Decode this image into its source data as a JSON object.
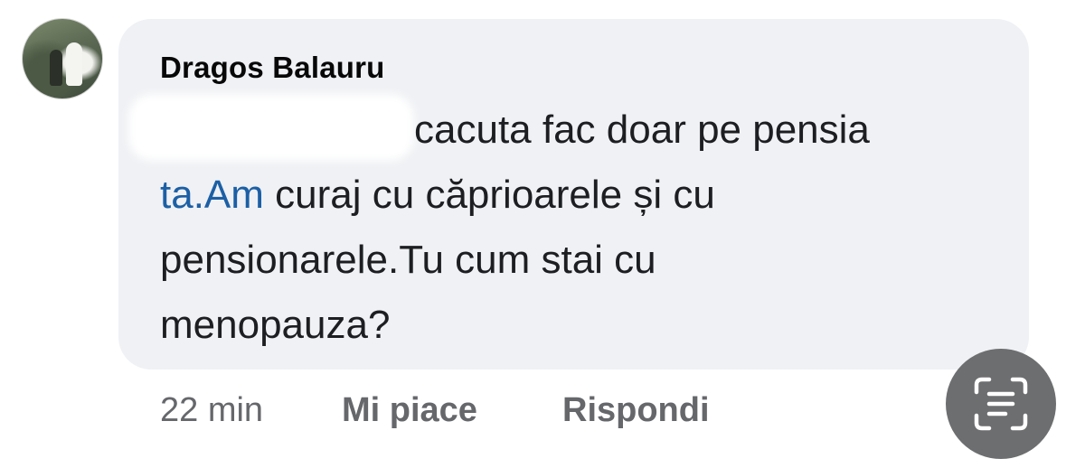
{
  "comment": {
    "author": "Dragos Balauru",
    "lines": [
      "cacuta  fac doar pe pensia",
      "curaj cu căprioarele și cu",
      "pensionarele.Tu cum stai cu",
      "menopauza?"
    ],
    "mention": "ta.Am",
    "mention_color": "#1c5fa5"
  },
  "actions": {
    "time": "22 min",
    "like": "Mi piace",
    "reply": "Rispondi"
  },
  "overlay": {
    "icon": "text-scan-icon"
  }
}
